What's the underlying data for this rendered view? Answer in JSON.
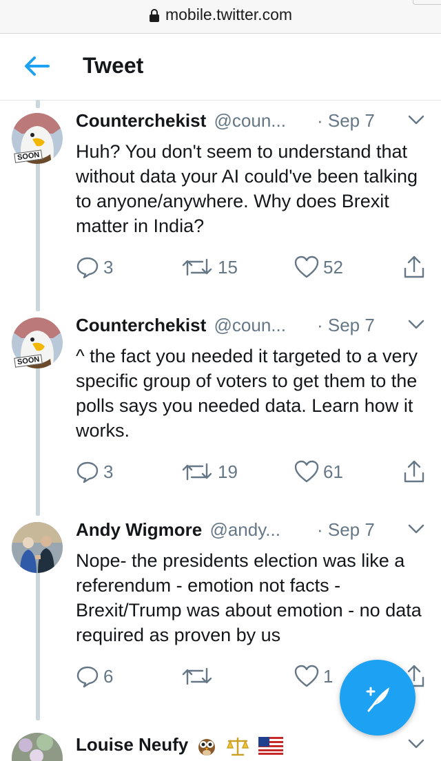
{
  "browser": {
    "url": "mobile.twitter.com"
  },
  "header": {
    "title": "Tweet"
  },
  "tweets": [
    {
      "name": "Counterchekist",
      "handle": "@coun...",
      "date": "· Sep 7",
      "avatar_badge": "SOON",
      "text": "Huh? You don't seem to understand that without data your AI could've been talking to anyone/anywhere. Why does Brexit matter in India?",
      "replies": "3",
      "retweets": "15",
      "likes": "52"
    },
    {
      "name": "Counterchekist",
      "handle": "@coun...",
      "date": "· Sep 7",
      "avatar_badge": "SOON",
      "text": "^ the fact you needed it targeted to a very specific group of voters to get them to the polls says you needed data. Learn how it works.",
      "replies": "3",
      "retweets": "19",
      "likes": "61"
    },
    {
      "name": "Andy Wigmore",
      "handle": "@andy...",
      "date": "· Sep 7",
      "text": "Nope-  the presidents election was like a referendum - emotion not facts - Brexit/Trump was about emotion - no data required as proven by us",
      "replies": "6",
      "retweets": "",
      "likes": "1"
    },
    {
      "name": "Louise Neufy",
      "emojis": [
        "owl-emoji",
        "scales-emoji",
        "us-flag-emoji"
      ]
    }
  ],
  "colors": {
    "accent": "#1da1f2",
    "text": "#14171a",
    "secondary": "#657786",
    "thread_line": "#ccd6dd"
  }
}
